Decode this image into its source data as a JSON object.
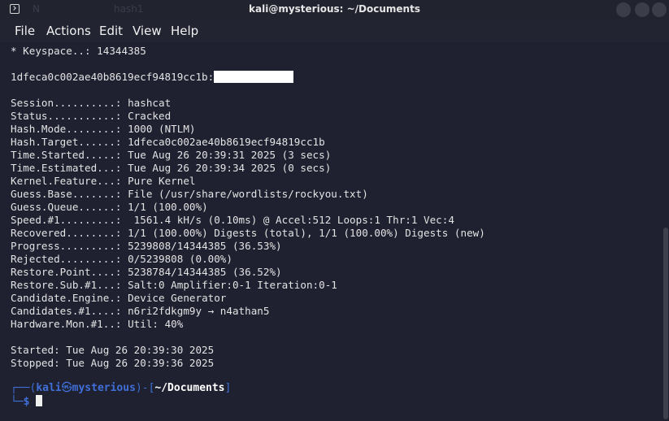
{
  "window": {
    "title": "kali@mysterious: ~/Documents",
    "ghost_text_1": "N",
    "ghost_text_2": "hash1"
  },
  "menu": {
    "items": [
      "File",
      "Actions",
      "Edit",
      "View",
      "Help"
    ]
  },
  "terminal": {
    "keyspace_line": "* Keyspace..: 14344385",
    "hash_prefix": "1dfeca0c002ae40b8619ecf94819cc1b:",
    "fields": [
      {
        "key": "Session..........:",
        "value": "hashcat"
      },
      {
        "key": "Status...........:",
        "value": "Cracked"
      },
      {
        "key": "Hash.Mode........:",
        "value": "1000 (NTLM)"
      },
      {
        "key": "Hash.Target......:",
        "value": "1dfeca0c002ae40b8619ecf94819cc1b"
      },
      {
        "key": "Time.Started.....:",
        "value": "Tue Aug 26 20:39:31 2025 (3 secs)"
      },
      {
        "key": "Time.Estimated...:",
        "value": "Tue Aug 26 20:39:34 2025 (0 secs)"
      },
      {
        "key": "Kernel.Feature...:",
        "value": "Pure Kernel"
      },
      {
        "key": "Guess.Base.......:",
        "value": "File (/usr/share/wordlists/rockyou.txt)"
      },
      {
        "key": "Guess.Queue......:",
        "value": "1/1 (100.00%)"
      },
      {
        "key": "Speed.#1.........:",
        "value": " 1561.4 kH/s (0.10ms) @ Accel:512 Loops:1 Thr:1 Vec:4"
      },
      {
        "key": "Recovered........:",
        "value": "1/1 (100.00%) Digests (total), 1/1 (100.00%) Digests (new)"
      },
      {
        "key": "Progress.........:",
        "value": "5239808/14344385 (36.53%)"
      },
      {
        "key": "Rejected.........:",
        "value": "0/5239808 (0.00%)"
      },
      {
        "key": "Restore.Point....:",
        "value": "5238784/14344385 (36.52%)"
      },
      {
        "key": "Restore.Sub.#1...:",
        "value": "Salt:0 Amplifier:0-1 Iteration:0-1"
      },
      {
        "key": "Candidate.Engine.:",
        "value": "Device Generator"
      },
      {
        "key": "Candidates.#1....:",
        "value": "n6ri2fdkgm9y → n4athan5"
      },
      {
        "key": "Hardware.Mon.#1..:",
        "value": "Util: 40%"
      }
    ],
    "started_line": "Started: Tue Aug 26 20:39:30 2025",
    "stopped_line": "Stopped: Tue Aug 26 20:39:36 2025",
    "prompt": {
      "open": "┌──(",
      "user": "kali",
      "at": "㉿",
      "host": "mysterious",
      "mid": ")-[",
      "path": "~/Documents",
      "close": "]",
      "line2_prefix": "└─",
      "symbol": "$"
    }
  }
}
